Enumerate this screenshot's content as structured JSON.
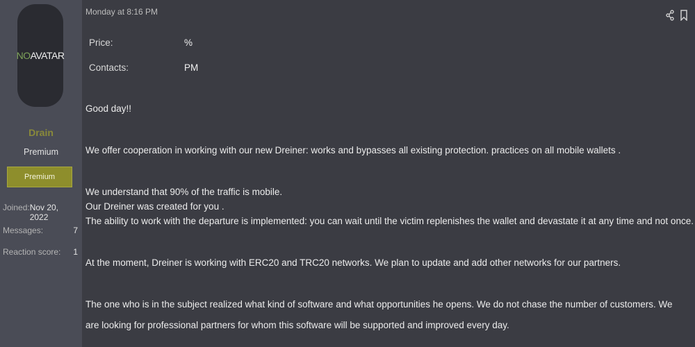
{
  "author": {
    "avatar_text_no": "NO",
    "avatar_text_rest": "AVATAR",
    "username": "Drain",
    "user_title": "Premium",
    "banner": "Premium",
    "stats": [
      {
        "label": "Joined:",
        "value": "Nov 20, 2022"
      },
      {
        "label": "Messages:",
        "value": "7"
      },
      {
        "label": "Reaction score:",
        "value": "1"
      }
    ]
  },
  "post": {
    "timestamp": "Monday at 8:16 PM",
    "share_icon": "share-icon",
    "bookmark_icon": "bookmark-icon",
    "fields": [
      {
        "label": "Price:",
        "value": "%"
      },
      {
        "label": "Contacts:",
        "value": "PM"
      }
    ],
    "paragraphs": [
      "Good day!!",
      "We offer cooperation in working with our new Dreiner: works and bypasses all existing protection. practices on all mobile wallets .",
      "We understand that 90% of the traffic is mobile.",
      "Our Dreiner was created for you .",
      "The ability to work with the departure is implemented: you can wait until the victim replenishes the wallet and devastate it at any time and not once.",
      "At the moment, Dreiner is working with ERC20 and TRC20 networks. We plan to update and add other networks for our partners.",
      "The one who is in the subject realized what kind of software and what opportunities he opens. We do not chase the number of customers. We are looking for professional partners for whom this software will be supported and improved every day."
    ]
  }
}
